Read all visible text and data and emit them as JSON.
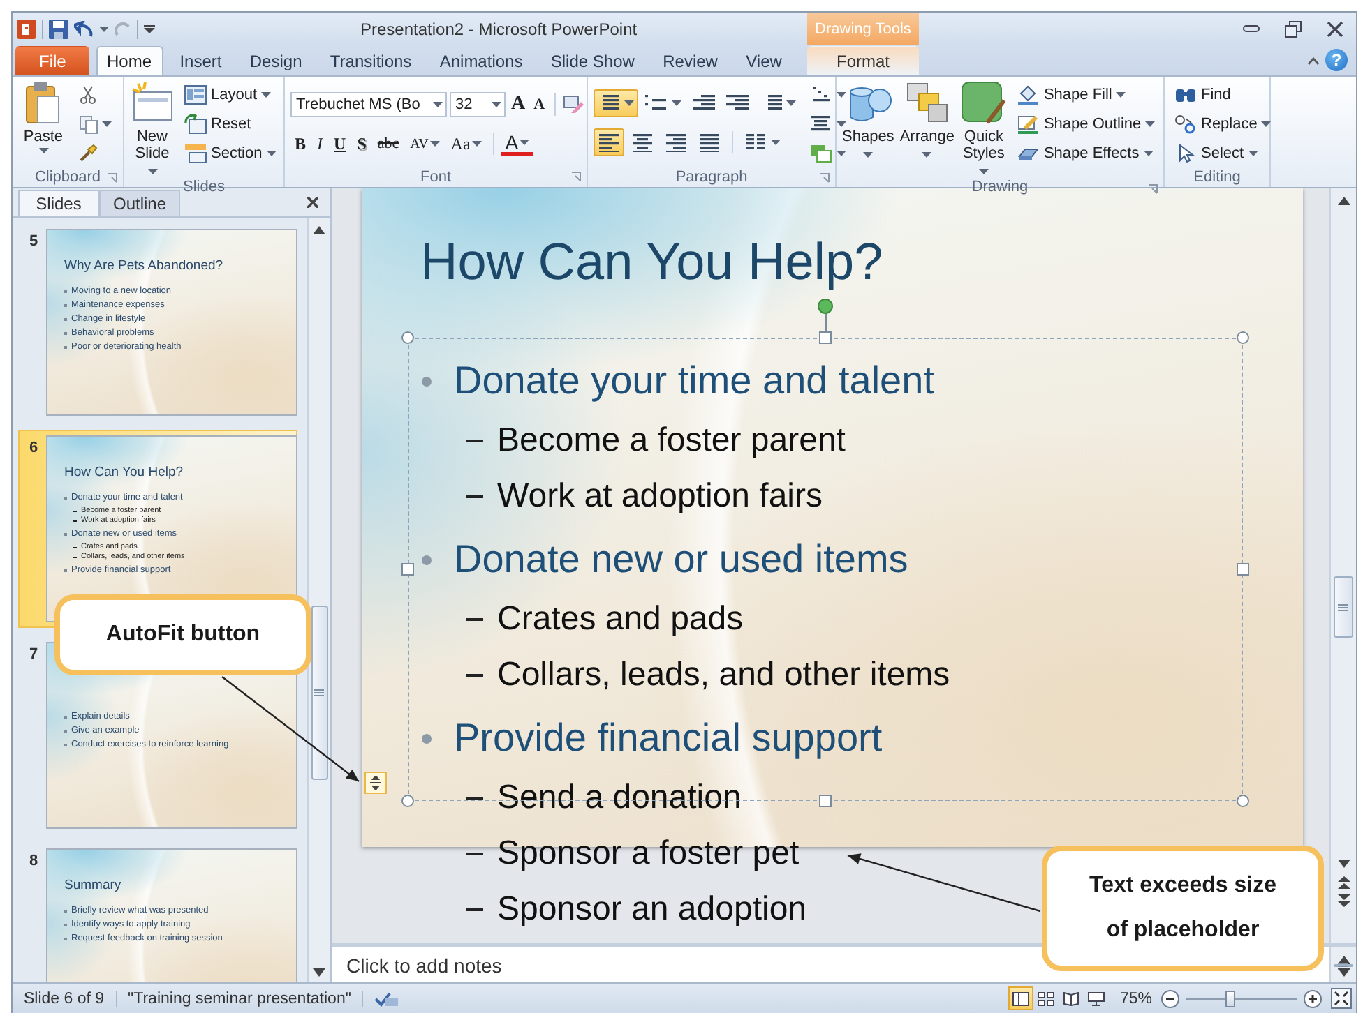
{
  "title_bar": {
    "title": "Presentation2 - Microsoft PowerPoint",
    "context_group": "Drawing Tools"
  },
  "tabs": [
    {
      "label": "File",
      "kind": "file",
      "selected": false
    },
    {
      "label": "Home",
      "kind": "normal",
      "selected": true
    },
    {
      "label": "Insert",
      "kind": "normal",
      "selected": false
    },
    {
      "label": "Design",
      "kind": "normal",
      "selected": false
    },
    {
      "label": "Transitions",
      "kind": "normal",
      "selected": false
    },
    {
      "label": "Animations",
      "kind": "normal",
      "selected": false
    },
    {
      "label": "Slide Show",
      "kind": "normal",
      "selected": false
    },
    {
      "label": "Review",
      "kind": "normal",
      "selected": false
    },
    {
      "label": "View",
      "kind": "normal",
      "selected": false
    },
    {
      "label": "Format",
      "kind": "contextual",
      "selected": false
    }
  ],
  "help": "?",
  "ribbon": {
    "clipboard": {
      "label": "Clipboard",
      "paste": "Paste"
    },
    "slides": {
      "label": "Slides",
      "new_slide": "New Slide",
      "commands": [
        {
          "label": "Layout",
          "kind": "layout",
          "dropdown": true
        },
        {
          "label": "Reset",
          "kind": "reset",
          "dropdown": false
        },
        {
          "label": "Section",
          "kind": "section",
          "dropdown": true
        }
      ]
    },
    "font": {
      "label": "Font",
      "font_name": "Trebuchet MS (Bo",
      "font_size": "32",
      "size_buttons": [
        "A",
        "A"
      ],
      "format_buttons": [
        {
          "label": "B",
          "kind": "bold",
          "dropdown": false
        },
        {
          "label": "I",
          "kind": "italic",
          "dropdown": false
        },
        {
          "label": "U",
          "kind": "underline",
          "dropdown": false
        },
        {
          "label": "S",
          "kind": "shadow",
          "dropdown": false
        },
        {
          "label": "abc",
          "kind": "strike",
          "dropdown": false
        },
        {
          "label": "AV",
          "kind": "spacing",
          "dropdown": true
        },
        {
          "label": "Aa",
          "kind": "case",
          "dropdown": true
        },
        {
          "label": "A",
          "kind": "color",
          "dropdown": true
        }
      ]
    },
    "paragraph": {
      "label": "Paragraph",
      "bullets_selected": true,
      "alignment": [
        {
          "kind": "left",
          "selected": true
        },
        {
          "kind": "center",
          "selected": false
        },
        {
          "kind": "right",
          "selected": false
        },
        {
          "kind": "justify",
          "selected": false
        }
      ]
    },
    "drawing": {
      "label": "Drawing",
      "large_buttons": [
        {
          "label": "Shapes",
          "kind": "shapes"
        },
        {
          "label": "Arrange",
          "kind": "arrange"
        },
        {
          "label": "Quick Styles",
          "kind": "styles"
        }
      ],
      "commands": [
        {
          "label": "Shape Fill",
          "kind": "fill"
        },
        {
          "label": "Shape Outline",
          "kind": "outline"
        },
        {
          "label": "Shape Effects",
          "kind": "effects"
        }
      ]
    },
    "editing": {
      "label": "Editing",
      "commands": [
        {
          "label": "Find",
          "kind": "find",
          "dropdown": false
        },
        {
          "label": "Replace",
          "kind": "replace",
          "dropdown": true
        },
        {
          "label": "Select",
          "kind": "select",
          "dropdown": true
        }
      ]
    }
  },
  "slides_panel": {
    "tabs": [
      {
        "label": "Slides",
        "selected": true
      },
      {
        "label": "Outline",
        "selected": false
      }
    ],
    "slides": [
      {
        "number": "5",
        "selected": false,
        "title": "Why Are Pets Abandoned?",
        "bullets": [
          {
            "text": "Moving to a new location"
          },
          {
            "text": "Maintenance expenses"
          },
          {
            "text": "Change in lifestyle"
          },
          {
            "text": "Behavioral problems"
          },
          {
            "text": "Poor or deteriorating health"
          }
        ]
      },
      {
        "number": "6",
        "selected": true,
        "title": "How Can You Help?",
        "bullets": [
          {
            "text": "Donate your time and talent",
            "children": [
              {
                "text": "Become a foster parent"
              },
              {
                "text": "Work at adoption fairs"
              }
            ]
          },
          {
            "text": "Donate new or used items",
            "children": [
              {
                "text": "Crates and pads"
              },
              {
                "text": "Collars, leads, and other items"
              }
            ]
          },
          {
            "text": "Provide financial support"
          }
        ]
      },
      {
        "number": "7",
        "selected": false,
        "bullets": [
          {
            "text": "Explain details"
          },
          {
            "text": "Give an example"
          },
          {
            "text": "Conduct exercises to reinforce learning"
          }
        ]
      },
      {
        "number": "8",
        "selected": false,
        "title": "Summary",
        "bullets": [
          {
            "text": "Briefly review what was presented"
          },
          {
            "text": "Identify ways to apply training"
          },
          {
            "text": "Request feedback on training session"
          }
        ]
      }
    ]
  },
  "slide": {
    "title": "How Can You Help?",
    "bullets": [
      {
        "text": "Donate your time and talent",
        "children": [
          {
            "text": "Become a foster parent"
          },
          {
            "text": "Work at adoption fairs"
          }
        ]
      },
      {
        "text": "Donate new or used items",
        "children": [
          {
            "text": "Crates and pads"
          },
          {
            "text": "Collars, leads, and other items"
          }
        ]
      },
      {
        "text": "Provide financial support",
        "children": [
          {
            "text": "Send a donation"
          },
          {
            "text": "Sponsor a foster pet"
          },
          {
            "text": "Sponsor an adoption"
          }
        ]
      }
    ]
  },
  "notes": {
    "placeholder": "Click to add notes"
  },
  "status_bar": {
    "slide_position": "Slide 6 of 9",
    "theme": "\"Training seminar presentation\"",
    "views": [
      {
        "kind": "normal",
        "selected": true
      },
      {
        "kind": "sorter",
        "selected": false
      },
      {
        "kind": "reading",
        "selected": false
      },
      {
        "kind": "show",
        "selected": false
      }
    ],
    "zoom": "75%",
    "zoom_slider": {
      "level": 0.4
    }
  },
  "callouts": [
    {
      "text": "AutoFit button"
    },
    {
      "text": "Text exceeds size of placeholder"
    }
  ]
}
